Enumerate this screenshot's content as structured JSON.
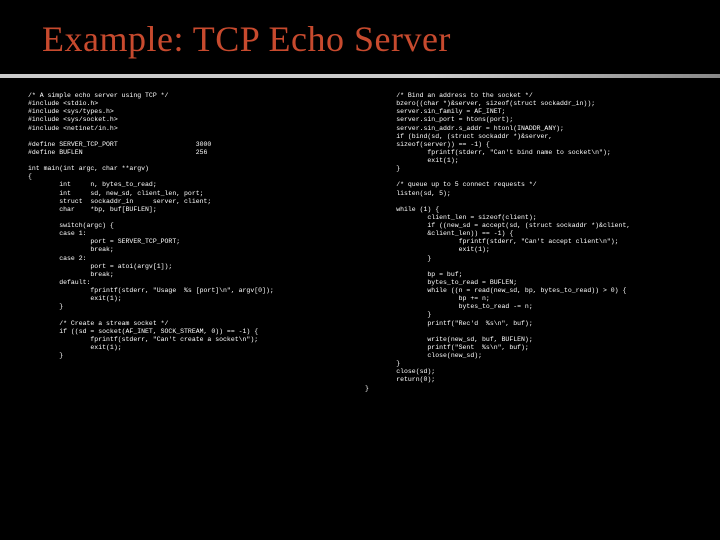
{
  "title": "Example: TCP Echo Server",
  "code_left": "/* A simple echo server using TCP */\n#include <stdio.h>\n#include <sys/types.h>\n#include <sys/socket.h>\n#include <netinet/in.h>\n\n#define SERVER_TCP_PORT                    3000\n#define BUFLEN                             256\n\nint main(int argc, char **argv)\n{\n        int     n, bytes_to_read;\n        int     sd, new_sd, client_len, port;\n        struct  sockaddr_in     server, client;\n        char    *bp, buf[BUFLEN];\n\n        switch(argc) {\n        case 1:\n                port = SERVER_TCP_PORT;\n                break;\n        case 2:\n                port = atoi(argv[1]);\n                break;\n        default:\n                fprintf(stderr, \"Usage  %s [port]\\n\", argv[0]);\n                exit(1);\n        }\n\n        /* Create a stream socket */\n        if ((sd = socket(AF_INET, SOCK_STREAM, 0)) == -1) {\n                fprintf(stderr, \"Can't create a socket\\n\");\n                exit(1);\n        }\n",
  "code_right": "        /* Bind an address to the socket */\n        bzero((char *)&server, sizeof(struct sockaddr_in));\n        server.sin_family = AF_INET;\n        server.sin_port = htons(port);\n        server.sin_addr.s_addr = htonl(INADDR_ANY);\n        if (bind(sd, (struct sockaddr *)&server,\n        sizeof(server)) == -1) {\n                fprintf(stderr, \"Can't bind name to socket\\n\");\n                exit(1);\n        }\n\n        /* queue up to 5 connect requests */\n        listen(sd, 5);\n\n        while (1) {\n                client_len = sizeof(client);\n                if ((new_sd = accept(sd, (struct sockaddr *)&client,\n                &client_len)) == -1) {\n                        fprintf(stderr, \"Can't accept client\\n\");\n                        exit(1);\n                }\n\n                bp = buf;\n                bytes_to_read = BUFLEN;\n                while ((n = read(new_sd, bp, bytes_to_read)) > 0) {\n                        bp += n;\n                        bytes_to_read -= n;\n                }\n                printf(\"Rec'd  %s\\n\", buf);\n\n                write(new_sd, buf, BUFLEN);\n                printf(\"Sent  %s\\n\", buf);\n                close(new_sd);\n        }\n        close(sd);\n        return(0);\n}\n"
}
